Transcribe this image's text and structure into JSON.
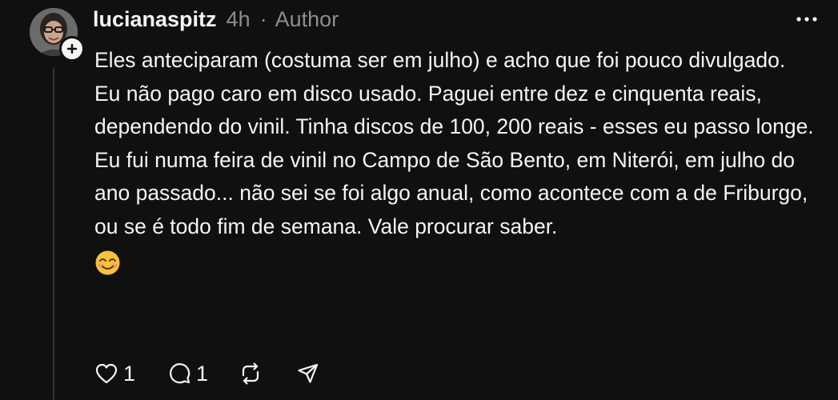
{
  "post": {
    "username": "lucianaspitz",
    "time": "4h",
    "separator": "·",
    "author_label": "Author",
    "paragraphs": [
      "Eles anteciparam (costuma ser em julho) e acho que foi pouco divulgado.",
      "Eu não pago caro em disco usado. Paguei entre dez e cinquenta reais, dependendo do vinil. Tinha discos de 100, 200 reais - esses eu passo longe.",
      "Eu fui numa feira de vinil no Campo de São Bento, em Niterói, em julho do ano passado... não sei se foi algo anual, como acontece com a de Friburgo, ou se é todo fim de semana. Vale procurar saber."
    ],
    "emoji_icon": "smiling-face-with-glasses-icon"
  },
  "actions": {
    "like_count": "1",
    "reply_count": "1",
    "icons": [
      "heart-icon",
      "comment-icon",
      "repost-icon",
      "share-icon"
    ]
  },
  "colors": {
    "background": "#101010",
    "text": "#f3f5f7",
    "muted": "#8d8d8d",
    "thread_line": "#333638"
  }
}
